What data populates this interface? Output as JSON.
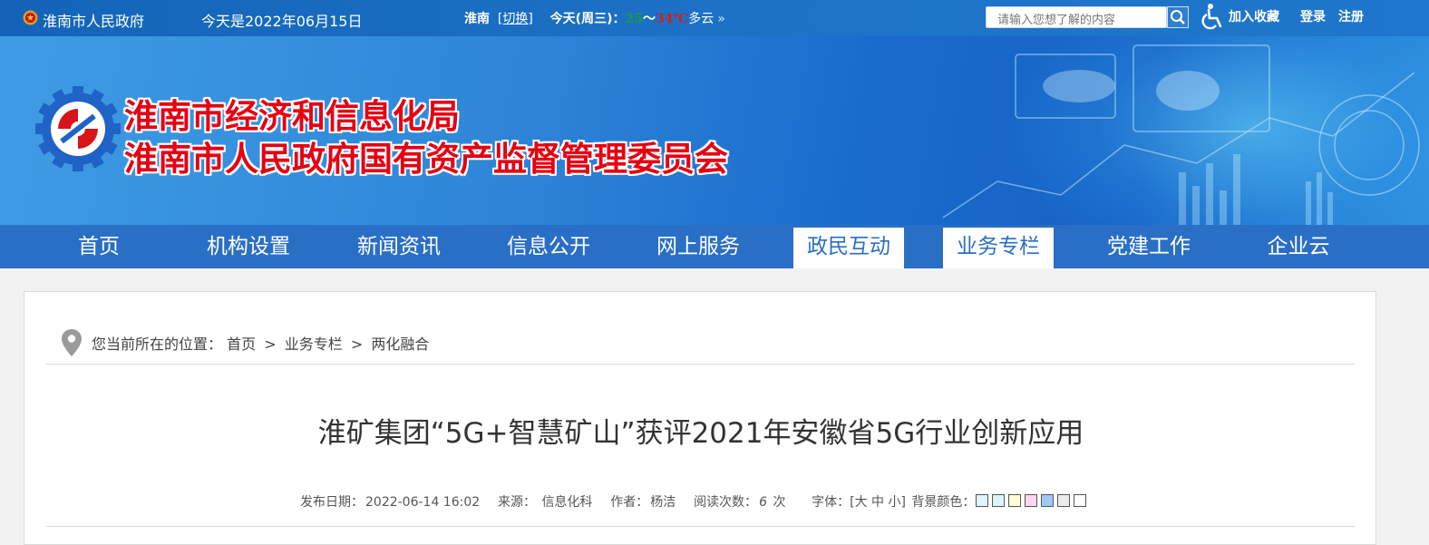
{
  "topbar": {
    "gov_link": "淮南市人民政府",
    "today": "今天是2022年06月15日",
    "city": "淮南",
    "switch": "切换",
    "today_label": "今天(周三)：",
    "temp_low": "25",
    "temp_sep": "～",
    "temp_high": "34℃",
    "condition": "多云",
    "more": "»",
    "search_placeholder": "请输入您想了解的内容",
    "favorite": "加入收藏",
    "login": "登录",
    "register": "注册"
  },
  "banner": {
    "title_line1": "淮南市经济和信息化局",
    "title_line2": "淮南市人民政府国有资产监督管理委员会"
  },
  "nav": {
    "items": [
      {
        "label": "首页"
      },
      {
        "label": "机构设置"
      },
      {
        "label": "新闻资讯"
      },
      {
        "label": "信息公开"
      },
      {
        "label": "网上服务"
      },
      {
        "label": "政民互动"
      },
      {
        "label": "业务专栏"
      },
      {
        "label": "党建工作"
      },
      {
        "label": "企业云"
      }
    ],
    "active_items": [
      "政民互动",
      "业务专栏"
    ]
  },
  "breadcrumb": {
    "prefix": "您当前所在的位置：",
    "items": [
      "首页",
      "业务专栏",
      "两化融合"
    ],
    "sep": ">"
  },
  "article": {
    "title": "淮矿集团“5G+智慧矿山”获评2021年安徽省5G行业创新应用",
    "publish_label": "发布日期：",
    "publish_date": "2022-06-14 16:02",
    "source_label": "来源：",
    "source": "信息化科",
    "author_label": "作者：",
    "author": "杨洁",
    "views_label": "阅读次数：",
    "views": "6",
    "views_unit": "次",
    "font_label": "字体：[大 中 小]",
    "bg_label": "背景颜色："
  },
  "bg_swatches": [
    "#e1f5ff",
    "#d9f7f7",
    "#fffbd6",
    "#ffd7ef",
    "#9ec9f5",
    "#ececec",
    "#ffffff"
  ],
  "colors": {
    "topbar": "#1c72c6",
    "nav": "#2a6fc6",
    "banner_title": "#e60012"
  }
}
